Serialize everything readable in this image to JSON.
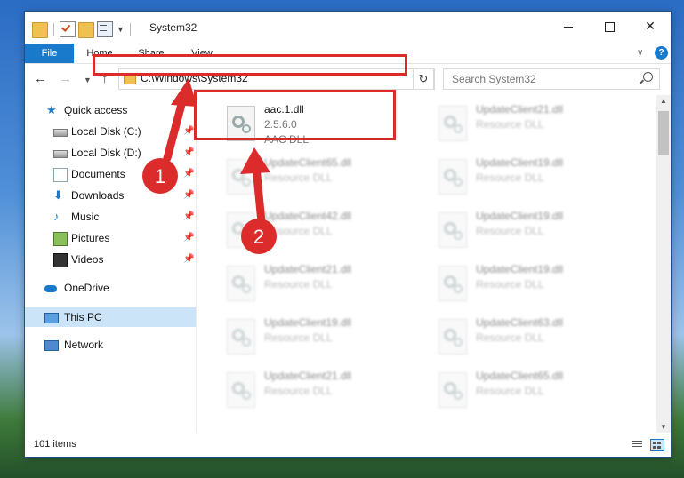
{
  "window": {
    "title": "System32",
    "controls": {
      "minimize": "",
      "maximize": "",
      "close": "✕"
    }
  },
  "ribbon": {
    "tabs": [
      "File",
      "Home",
      "Share",
      "View"
    ],
    "help": "?"
  },
  "address": {
    "path": "C:\\Windows\\System32",
    "search_placeholder": "Search System32"
  },
  "navpane": {
    "items": [
      {
        "label": "Quick access",
        "icon": "star-icon"
      },
      {
        "label": "Local Disk (C:)",
        "icon": "drive-icon"
      },
      {
        "label": "Local Disk (D:)",
        "icon": "drive-icon"
      },
      {
        "label": "Documents",
        "icon": "documents-icon"
      },
      {
        "label": "Downloads",
        "icon": "downloads-icon"
      },
      {
        "label": "Music",
        "icon": "music-icon"
      },
      {
        "label": "Pictures",
        "icon": "pictures-icon"
      },
      {
        "label": "Videos",
        "icon": "videos-icon"
      },
      {
        "label": "OneDrive",
        "icon": "onedrive-icon"
      },
      {
        "label": "This PC",
        "icon": "this-pc-icon"
      },
      {
        "label": "Network",
        "icon": "network-icon"
      }
    ]
  },
  "files": [
    {
      "name": "aac.1.dll",
      "line2": "2.5.6.0",
      "line3": "AAC DLL"
    },
    {
      "name": "UpdateClient21.dll",
      "line2": "Resource DLL"
    },
    {
      "name": "UpdateClient65.dll",
      "line2": "Resource DLL"
    },
    {
      "name": "UpdateClient19.dll",
      "line2": "Resource DLL"
    },
    {
      "name": "UpdateClient42.dll",
      "line2": "Resource DLL"
    },
    {
      "name": "UpdateClient19.dll",
      "line2": "Resource DLL"
    },
    {
      "name": "UpdateClient21.dll",
      "line2": "Resource DLL"
    },
    {
      "name": "UpdateClient19.dll",
      "line2": "Resource DLL"
    },
    {
      "name": "UpdateClient19.dll",
      "line2": "Resource DLL"
    },
    {
      "name": "UpdateClient63.dll",
      "line2": "Resource DLL"
    },
    {
      "name": "UpdateClient21.dll",
      "line2": "Resource DLL"
    },
    {
      "name": "UpdateClient65.dll",
      "line2": "Resource DLL"
    }
  ],
  "status": {
    "item_count": "101 items"
  },
  "annotations": {
    "step1": "1",
    "step2": "2",
    "color": "#dc2b2b"
  }
}
